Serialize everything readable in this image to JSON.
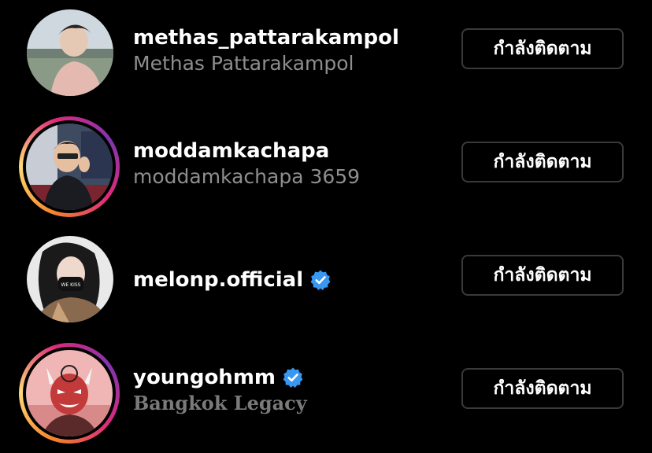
{
  "following_list": [
    {
      "username": "methas_pattarakampol",
      "full_name": "Methas Pattarakampol",
      "verified": false,
      "has_story_ring": false,
      "button_label": "กำลังติดตาม"
    },
    {
      "username": "moddamkachapa",
      "full_name": "moddamkachapa 3659",
      "verified": false,
      "has_story_ring": true,
      "button_label": "กำลังติดตาม"
    },
    {
      "username": "melonp.official",
      "full_name": "",
      "verified": true,
      "has_story_ring": false,
      "button_label": "กำลังติดตาม"
    },
    {
      "username": "youngohmm",
      "full_name": "Bangkok Legacy",
      "verified": true,
      "has_story_ring": true,
      "button_label": "กำลังติดตาม"
    }
  ],
  "colors": {
    "background": "#000000",
    "username": "#ffffff",
    "full_name": "#8e8e8e",
    "verified_badge": "#3897f0",
    "button_border": "#3a3a3a"
  },
  "icons": {
    "verified": "verified-badge-icon"
  }
}
